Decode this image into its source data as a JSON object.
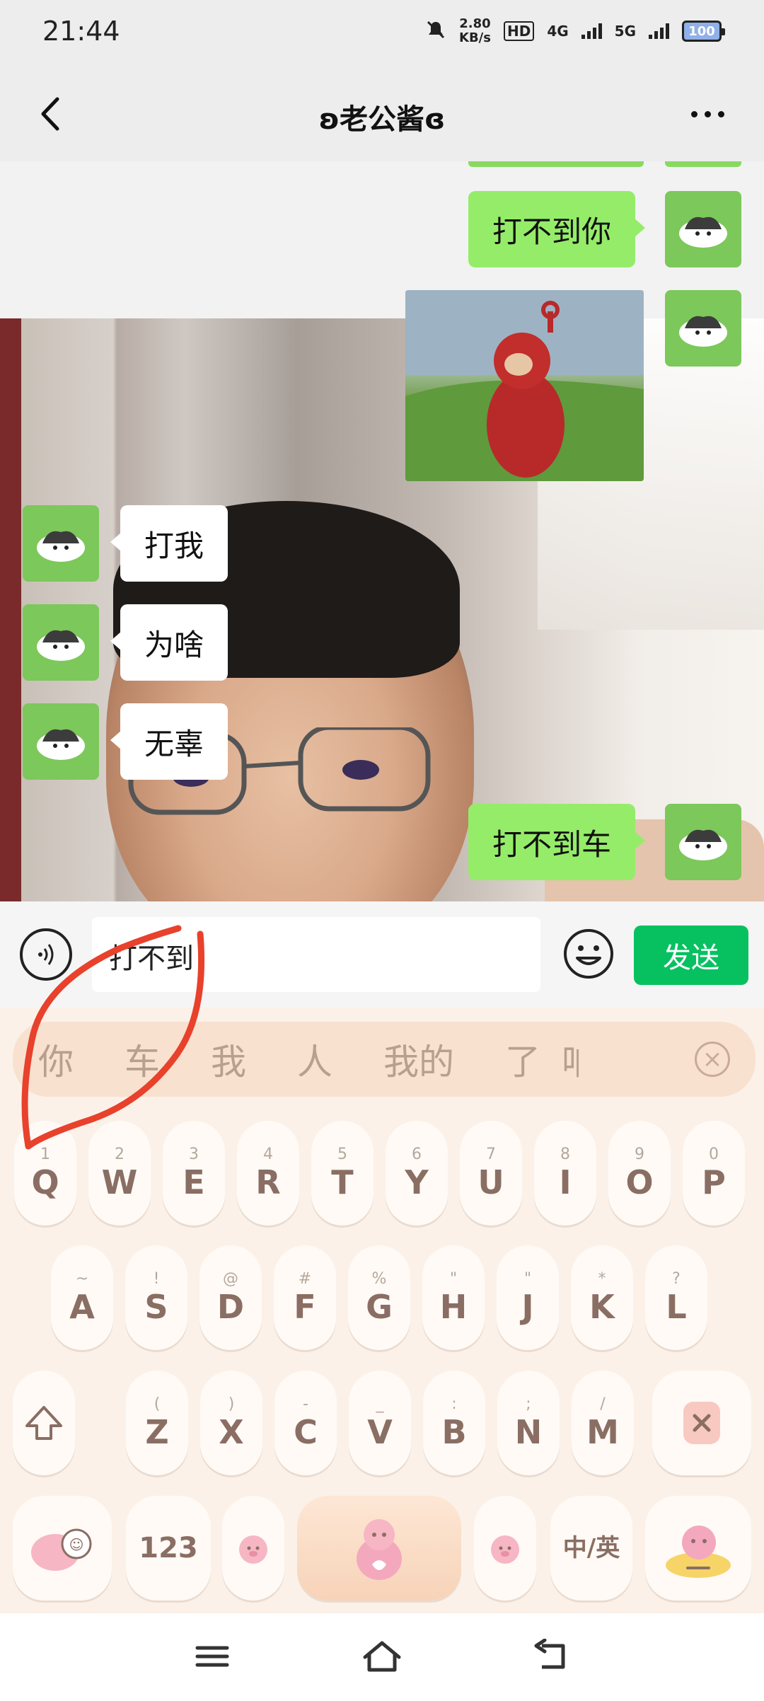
{
  "status_bar": {
    "time": "21:44",
    "net_speed_value": "2.80",
    "net_speed_unit": "KB/s",
    "hd_label": "HD",
    "sim1_label": "4G",
    "sim2_label": "5G",
    "battery": "100"
  },
  "header": {
    "title": "ʚ老公酱ɞ"
  },
  "messages": [
    {
      "side": "mine",
      "type": "text",
      "text": "打不到你"
    },
    {
      "side": "mine",
      "type": "image",
      "icon": "red-teletubby-photo"
    },
    {
      "side": "theirs",
      "type": "text",
      "text": "打我"
    },
    {
      "side": "theirs",
      "type": "text",
      "text": "为啥"
    },
    {
      "side": "theirs",
      "type": "text",
      "text": "无辜"
    },
    {
      "side": "mine",
      "type": "text",
      "text": "打不到车"
    }
  ],
  "input_bar": {
    "value": "打不到",
    "send_label": "发送"
  },
  "keyboard": {
    "candidates": [
      "你",
      "车",
      "我",
      "人",
      "我的",
      "了",
      "咱"
    ],
    "row1": [
      {
        "main": "Q",
        "sub": "1"
      },
      {
        "main": "W",
        "sub": "2"
      },
      {
        "main": "E",
        "sub": "3"
      },
      {
        "main": "R",
        "sub": "4"
      },
      {
        "main": "T",
        "sub": "5"
      },
      {
        "main": "Y",
        "sub": "6"
      },
      {
        "main": "U",
        "sub": "7"
      },
      {
        "main": "I",
        "sub": "8"
      },
      {
        "main": "O",
        "sub": "9"
      },
      {
        "main": "P",
        "sub": "0"
      }
    ],
    "row2": [
      {
        "main": "A",
        "sub": "~"
      },
      {
        "main": "S",
        "sub": "!"
      },
      {
        "main": "D",
        "sub": "@"
      },
      {
        "main": "F",
        "sub": "#"
      },
      {
        "main": "G",
        "sub": "%"
      },
      {
        "main": "H",
        "sub": "\""
      },
      {
        "main": "J",
        "sub": "\""
      },
      {
        "main": "K",
        "sub": "*"
      },
      {
        "main": "L",
        "sub": "?"
      }
    ],
    "row3": [
      {
        "main": "Z",
        "sub": "("
      },
      {
        "main": "X",
        "sub": ")"
      },
      {
        "main": "C",
        "sub": "-"
      },
      {
        "main": "V",
        "sub": "_"
      },
      {
        "main": "B",
        "sub": ":"
      },
      {
        "main": "N",
        "sub": ";"
      },
      {
        "main": "M",
        "sub": "/"
      }
    ],
    "numbers_label": "123",
    "lang_label": "中/英"
  },
  "colors": {
    "accent": "#07c160",
    "my_bubble": "#95ec69",
    "annotation": "#e8412c"
  }
}
